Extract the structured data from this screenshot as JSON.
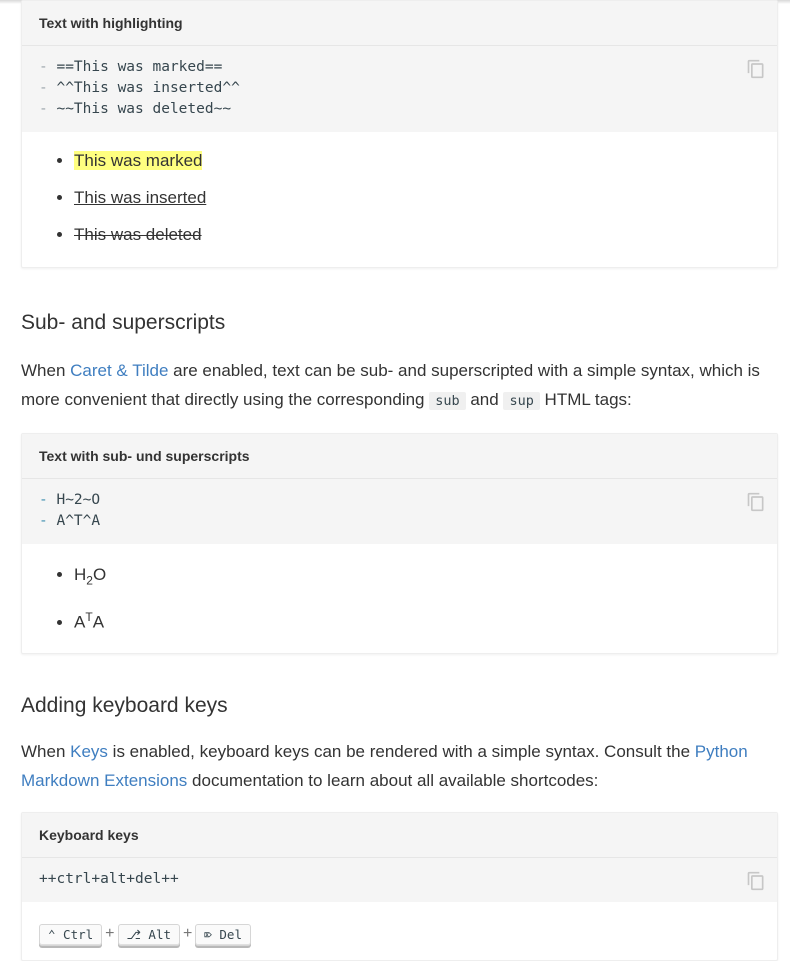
{
  "highlight": {
    "title": "Text with highlighting",
    "code": [
      "==This was marked==",
      "^^This was inserted^^",
      "~~This was deleted~~"
    ],
    "results": {
      "marked": "This was marked",
      "inserted": "This was inserted",
      "deleted": "This was deleted"
    }
  },
  "subsup": {
    "heading": "Sub- and superscripts",
    "para": {
      "t1": "When ",
      "link": "Caret & Tilde",
      "t2": " are enabled, text can be sub- and superscripted with a simple syntax, which is more convenient that directly using the corresponding ",
      "code_sub": "sub",
      "t3": " and ",
      "code_sup": "sup",
      "t4": " HTML tags:"
    },
    "example_title": "Text with sub- und superscripts",
    "code": [
      "H~2~O",
      "A^T^A"
    ],
    "results": {
      "h": "H",
      "two": "2",
      "o": "O",
      "a1": "A",
      "t": "T",
      "a2": "A"
    }
  },
  "keys": {
    "heading": "Adding keyboard keys",
    "para": {
      "t1": "When ",
      "link1": "Keys",
      "t2": " is enabled, keyboard keys can be rendered with a simple syntax. Consult the ",
      "link2": "Python Markdown Extensions",
      "t3": " documentation to learn about all available shortcodes:"
    },
    "example_title": "Keyboard keys",
    "code": "++ctrl+alt+del++",
    "result": {
      "ctrl": "⌃ Ctrl",
      "alt": "⎇ Alt",
      "del": "⌦ Del",
      "plus": "+"
    }
  },
  "dash": "-",
  "icons": {
    "copy": "copy-icon"
  },
  "colors": {
    "link": "#3f7ec0",
    "mark": "#ffff80",
    "code_bg": "#f5f5f5"
  }
}
